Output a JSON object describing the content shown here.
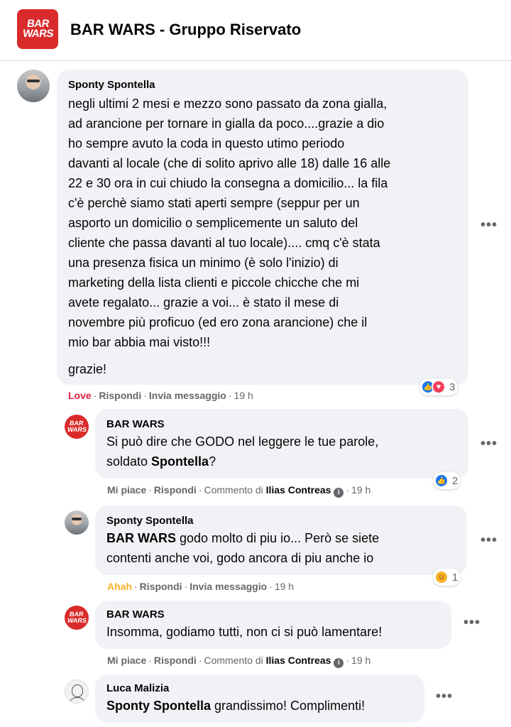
{
  "header": {
    "logo_text_1": "BAR",
    "logo_text_2": "WARS",
    "title": "BAR WARS - Gruppo Riservato"
  },
  "comments": [
    {
      "author": "Sponty Spontella",
      "lines": [
        "negli ultimi 2 mesi e mezzo sono passato da zona gialla,",
        "ad arancione per tornare in gialla da poco....grazie a dio",
        "ho sempre avuto la coda in questo utimo periodo",
        "davanti al locale (che di solito aprivo alle 18) dalle 16 alle",
        "22 e 30 ora in cui chiudo la consegna a domicilio... la fila",
        "c'è perchè siamo stati aperti sempre (seppur per un",
        "asporto un domicilio o semplicemente un saluto del",
        "cliente che passa davanti al tuo locale).... cmq c'è stata",
        "una presenza fisica un minimo (è solo l'inizio) di",
        "marketing della lista clienti e piccole chicche che mi",
        "avete regalato... grazie a voi... è stato il mese di",
        "novembre più proficuo (ed ero zona arancione) che il",
        "mio bar abbia mai visto!!!"
      ],
      "last_line": "grazie!",
      "reaction_label": "Love",
      "reply": "Rispondi",
      "message": "Invia messaggio",
      "time": "19 h",
      "reaction_count": "3"
    },
    {
      "author": "BAR WARS",
      "line1": "Si può dire che GODO nel leggere le tue parole,",
      "line2_pre": "soldato ",
      "line2_mention": "Spontella",
      "line2_post": "?",
      "reaction_label": "Mi piace",
      "reply": "Rispondi",
      "comment_by_label": "Commento di",
      "comment_by": "Ilias Contreas",
      "time": "19 h",
      "reaction_count": "2"
    },
    {
      "author": "Sponty Spontella",
      "mention": "BAR WARS",
      "line1_post": " godo molto di piu io... Però se siete",
      "line2": "contenti anche voi, godo ancora di piu anche io",
      "reaction_label": "Ahah",
      "reply": "Rispondi",
      "message": "Invia messaggio",
      "time": "19 h",
      "reaction_count": "1"
    },
    {
      "author": "BAR WARS",
      "line1": "Insomma, godiamo tutti, non ci si può lamentare!",
      "reaction_label": "Mi piace",
      "reply": "Rispondi",
      "comment_by_label": "Commento di",
      "comment_by": "Ilias Contreas",
      "time": "19 h"
    },
    {
      "author": "Luca Malizia",
      "mention": "Sponty Spontella",
      "line1_post": " grandissimo! Complimenti!"
    }
  ],
  "ui": {
    "separator": "·",
    "more_icon": "•••",
    "info_icon": "i"
  },
  "colors": {
    "brand_red": "#d92b2b",
    "love_red": "#e41e3f",
    "haha_yellow": "#f7b125",
    "like_blue": "#1877f2",
    "bubble_gray": "#f0f2f5",
    "meta_gray": "#65676b"
  }
}
